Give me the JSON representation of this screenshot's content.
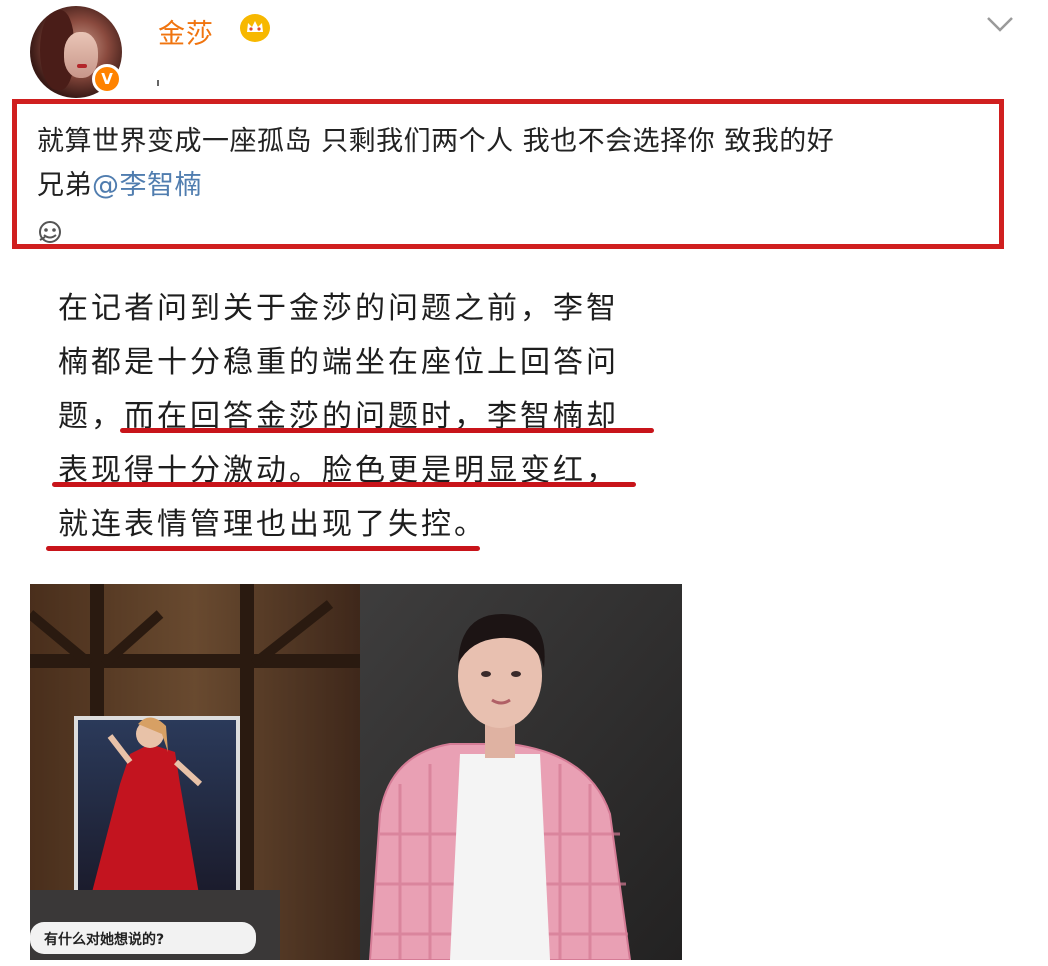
{
  "post": {
    "username": "金莎",
    "verified_badge": "V",
    "vip_badge_icon": "vip-crown-icon",
    "collapse_icon": "chevron-down-icon",
    "text_line1": "就算世界变成一座孤岛 只剩我们两个人 我也不会选择你  致我的好",
    "text_line2_prefix": "兄弟",
    "mention": "@李智楠",
    "mention_color": "#507daf",
    "username_color": "#f0740f",
    "highlight_box_color": "#d01f1f"
  },
  "commentary": {
    "line1": "在记者问到关于金莎的问题之前，李智",
    "line2": "楠都是十分稳重的端坐在座位上回答问",
    "line3": "题，而在回答金莎的问题时，李智楠却",
    "line4": "表现得十分激动。脸色更是明显变红，",
    "line5": "就连表情管理也出现了失控。",
    "underline_color": "#c8141a"
  },
  "video": {
    "caption": "有什么对她想说的?"
  }
}
